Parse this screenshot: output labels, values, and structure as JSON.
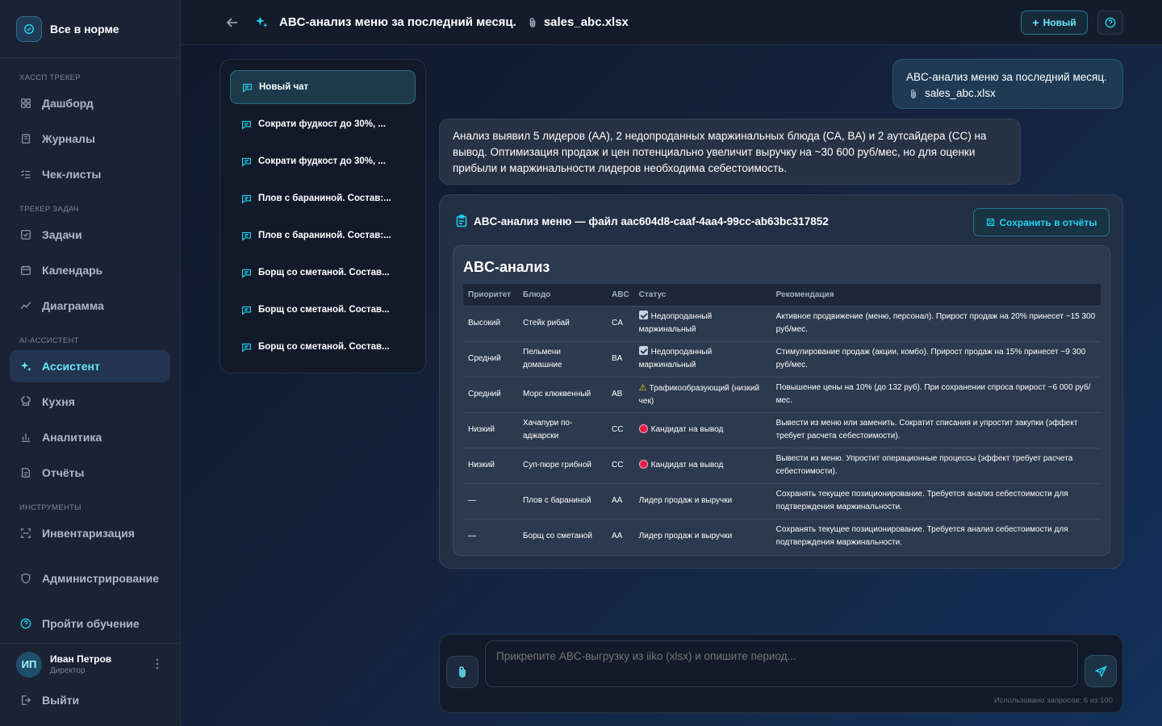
{
  "brand": {
    "title": "Все в норме"
  },
  "sidebar": {
    "sections": [
      {
        "title": "ХАССП ТРЕКЕР",
        "items": [
          {
            "label": "Дашборд",
            "icon": "dashboard-icon"
          },
          {
            "label": "Журналы",
            "icon": "book-icon"
          },
          {
            "label": "Чек-листы",
            "icon": "checklist-icon"
          }
        ]
      },
      {
        "title": "ТРЕКЕР ЗАДАЧ",
        "items": [
          {
            "label": "Задачи",
            "icon": "task-icon"
          },
          {
            "label": "Календарь",
            "icon": "calendar-icon"
          },
          {
            "label": "Диаграмма",
            "icon": "trend-icon"
          }
        ]
      },
      {
        "title": "AI-АССИСТЕНТ",
        "items": [
          {
            "label": "Ассистент",
            "icon": "sparkle-icon",
            "active": true
          },
          {
            "label": "Кухня",
            "icon": "chef-hat-icon"
          },
          {
            "label": "Аналитика",
            "icon": "bar-chart-icon"
          },
          {
            "label": "Отчёты",
            "icon": "report-icon"
          }
        ]
      },
      {
        "title": "ИНСТРУМЕНТЫ",
        "items": [
          {
            "label": "Инвентаризация",
            "icon": "scan-icon"
          }
        ]
      }
    ],
    "admin": "Администрирование",
    "tutorial": "Пройти обучение",
    "user": {
      "initials": "ИП",
      "name": "Иван Петров",
      "role": "Директор"
    },
    "logout": "Выйти"
  },
  "topbar": {
    "title": "ABC-анализ меню за последний месяц.",
    "file": "sales_abc.xlsx",
    "new_button": "Новый"
  },
  "chats": [
    "Новый чат",
    "Сократи фудкост до 30%, ...",
    "Сократи фудкост до 30%, ...",
    "Плов с бараниной. Состав:...",
    "Плов с бараниной. Состав:...",
    "Борщ со сметаной. Состав...",
    "Борщ со сметаной. Состав...",
    "Борщ со сметаной. Состав..."
  ],
  "user_message": {
    "line1": "ABC-анализ меню за последний месяц.",
    "file": "sales_abc.xlsx"
  },
  "assistant_message": "Анализ выявил 5 лидеров (AA), 2 недопроданных маржинальных блюда (CA, BA) и 2 аутсайдера (CC) на вывод. Оптимизация продаж и цен потенциально увеличит выручку на ~30 600 руб/мес, но для оценки прибыли и маржинальности лидеров необходима себестоимость.",
  "report": {
    "title": "ABC-анализ меню — файл aac604d8-caaf-4aa4-99cc-ab63bc317852",
    "save_button": "Сохранить в отчёты",
    "table_title": "ABC-анализ",
    "columns": [
      "Приоритет",
      "Блюдо",
      "ABC",
      "Статус",
      "Рекомендация"
    ],
    "rows": [
      {
        "priority": "Высокий",
        "dish": "Стейк рибай",
        "abc": "CA",
        "status": "Недопроданный маржинальный",
        "status_icon": "check",
        "rec": "Активное продвижение (меню, персонал). Прирост продаж на 20% принесет ~15 300 руб/мес."
      },
      {
        "priority": "Средний",
        "dish": "Пельмени домашние",
        "abc": "BA",
        "status": "Недопроданный маржинальный",
        "status_icon": "check",
        "rec": "Стимулирование продаж (акции, комбо). Прирост продаж на 15% принесет ~9 300 руб/мес."
      },
      {
        "priority": "Средний",
        "dish": "Морс клюквенный",
        "abc": "AB",
        "status": "Трафикообразующий (низкий чек)",
        "status_icon": "warning",
        "rec": "Повышение цены на 10% (до 132 руб). При сохранении спроса прирост ~6 000 руб/мес."
      },
      {
        "priority": "Низкий",
        "dish": "Хачапури по-аджарски",
        "abc": "CC",
        "status": "Кандидат на вывод",
        "status_icon": "red",
        "rec": "Вывести из меню или заменить. Сократит списания и упростит закупки (эффект требует расчета себестоимости)."
      },
      {
        "priority": "Низкий",
        "dish": "Суп-пюре грибной",
        "abc": "CC",
        "status": "Кандидат на вывод",
        "status_icon": "red",
        "rec": "Вывести из меню. Упростит операционные процессы (эффект требует расчета себестоимости)."
      },
      {
        "priority": "—",
        "dish": "Плов с бараниной",
        "abc": "AA",
        "status": "Лидер продаж и выручки",
        "status_icon": "",
        "rec": "Сохранять текущее позиционирование. Требуется анализ себестоимости для подтверждения маржинальности."
      },
      {
        "priority": "—",
        "dish": "Борщ со сметаной",
        "abc": "AA",
        "status": "Лидер продаж и выручки",
        "status_icon": "",
        "rec": "Сохранять текущее позиционирование. Требуется анализ себестоимости для подтверждения маржинальности."
      }
    ]
  },
  "composer": {
    "placeholder": "Прикрепите ABC-выгрузку из iiko (xlsx) и опишите период...",
    "usage": "Использовано запросов: 6 из 100"
  },
  "colors": {
    "accent": "#22d3ee",
    "danger": "#e11d48",
    "warning": "#facc15"
  }
}
